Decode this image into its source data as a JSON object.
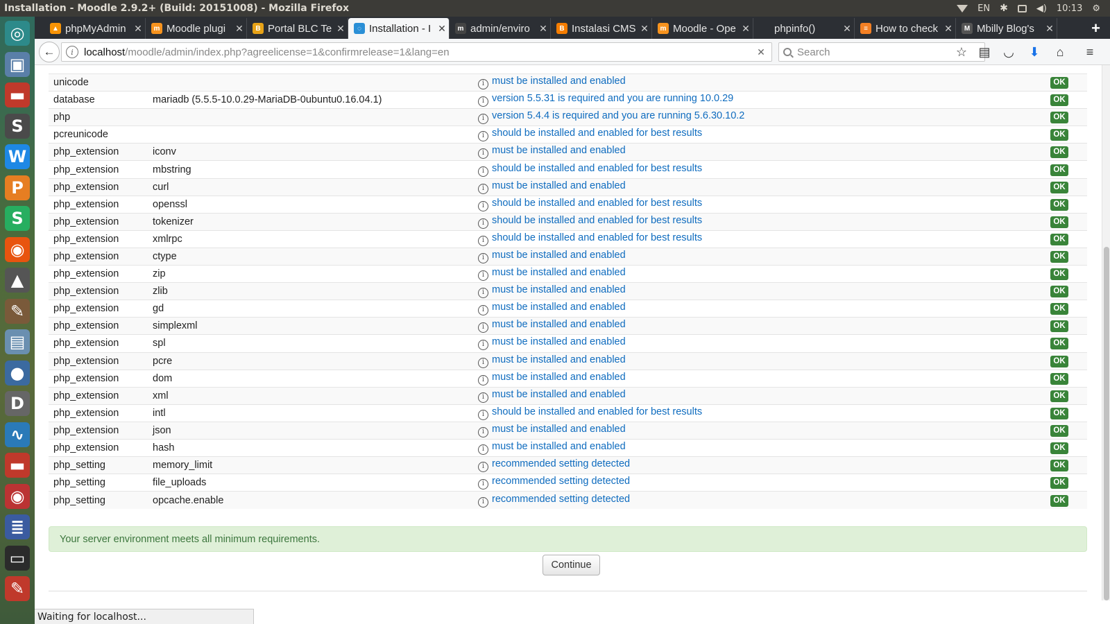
{
  "window": {
    "title": "Installation - Moodle 2.9.2+ (Build: 20151008) - Mozilla Firefox"
  },
  "system": {
    "language": "EN",
    "time": "10:13"
  },
  "tabs": [
    {
      "label": "phpMyAdmin",
      "favicon": "phpmyadmin-icon",
      "color": "#f89406",
      "glyph": "▲"
    },
    {
      "label": "Moodle plugi",
      "favicon": "moodle-icon",
      "color": "#f7931e",
      "glyph": "m"
    },
    {
      "label": "Portal BLC Te",
      "favicon": "blc-icon",
      "color": "#e8a317",
      "glyph": "B"
    },
    {
      "label": "Installation - I",
      "favicon": "loading-icon",
      "color": "#2a8fd6",
      "glyph": "◌",
      "active": true
    },
    {
      "label": "admin/enviro",
      "favicon": "moodle-icon",
      "color": "#444",
      "glyph": "m"
    },
    {
      "label": "Instalasi CMS",
      "favicon": "blogger-icon",
      "color": "#f57d00",
      "glyph": "B"
    },
    {
      "label": "Moodle - Ope",
      "favicon": "moodle-icon",
      "color": "#f7931e",
      "glyph": "m"
    },
    {
      "label": "phpinfo()",
      "favicon": "",
      "color": "transparent",
      "glyph": ""
    },
    {
      "label": "How to check",
      "favicon": "stackoverflow-icon",
      "color": "#f48024",
      "glyph": "≡"
    },
    {
      "label": "Mbilly Blog's",
      "favicon": "blog-icon",
      "color": "#555",
      "glyph": "M"
    }
  ],
  "nav": {
    "url_host": "localhost",
    "url_path": "/moodle/admin/index.php?agreelicense=1&confirmrelease=1&lang=en",
    "search_placeholder": "Search"
  },
  "environment": {
    "rows": [
      {
        "name": "unicode",
        "info": "",
        "report": "must be installed and enabled",
        "status": "OK"
      },
      {
        "name": "database",
        "info": "mariadb (5.5.5-10.0.29-MariaDB-0ubuntu0.16.04.1)",
        "report": "version 5.5.31 is required and you are running 10.0.29",
        "status": "OK"
      },
      {
        "name": "php",
        "info": "",
        "report": "version 5.4.4 is required and you are running 5.6.30.10.2",
        "status": "OK"
      },
      {
        "name": "pcreunicode",
        "info": "",
        "report": "should be installed and enabled for best results",
        "status": "OK"
      },
      {
        "name": "php_extension",
        "info": "iconv",
        "report": "must be installed and enabled",
        "status": "OK"
      },
      {
        "name": "php_extension",
        "info": "mbstring",
        "report": "should be installed and enabled for best results",
        "status": "OK"
      },
      {
        "name": "php_extension",
        "info": "curl",
        "report": "must be installed and enabled",
        "status": "OK"
      },
      {
        "name": "php_extension",
        "info": "openssl",
        "report": "should be installed and enabled for best results",
        "status": "OK"
      },
      {
        "name": "php_extension",
        "info": "tokenizer",
        "report": "should be installed and enabled for best results",
        "status": "OK"
      },
      {
        "name": "php_extension",
        "info": "xmlrpc",
        "report": "should be installed and enabled for best results",
        "status": "OK"
      },
      {
        "name": "php_extension",
        "info": "ctype",
        "report": "must be installed and enabled",
        "status": "OK"
      },
      {
        "name": "php_extension",
        "info": "zip",
        "report": "must be installed and enabled",
        "status": "OK"
      },
      {
        "name": "php_extension",
        "info": "zlib",
        "report": "must be installed and enabled",
        "status": "OK"
      },
      {
        "name": "php_extension",
        "info": "gd",
        "report": "must be installed and enabled",
        "status": "OK"
      },
      {
        "name": "php_extension",
        "info": "simplexml",
        "report": "must be installed and enabled",
        "status": "OK"
      },
      {
        "name": "php_extension",
        "info": "spl",
        "report": "must be installed and enabled",
        "status": "OK"
      },
      {
        "name": "php_extension",
        "info": "pcre",
        "report": "must be installed and enabled",
        "status": "OK"
      },
      {
        "name": "php_extension",
        "info": "dom",
        "report": "must be installed and enabled",
        "status": "OK"
      },
      {
        "name": "php_extension",
        "info": "xml",
        "report": "must be installed and enabled",
        "status": "OK"
      },
      {
        "name": "php_extension",
        "info": "intl",
        "report": "should be installed and enabled for best results",
        "status": "OK"
      },
      {
        "name": "php_extension",
        "info": "json",
        "report": "must be installed and enabled",
        "status": "OK"
      },
      {
        "name": "php_extension",
        "info": "hash",
        "report": "must be installed and enabled",
        "status": "OK"
      },
      {
        "name": "php_setting",
        "info": "memory_limit",
        "report": "recommended setting detected",
        "status": "OK"
      },
      {
        "name": "php_setting",
        "info": "file_uploads",
        "report": "recommended setting detected",
        "status": "OK"
      },
      {
        "name": "php_setting",
        "info": "opcache.enable",
        "report": "recommended setting detected",
        "status": "OK"
      }
    ],
    "summary": "Your server environment meets all minimum requirements.",
    "continue_label": "Continue"
  },
  "status_bar": {
    "text": "Waiting for localhost..."
  },
  "launcher_icons": [
    {
      "name": "dash-icon",
      "color": "#2d8a8a",
      "glyph": "◎"
    },
    {
      "name": "screenshot-icon",
      "color": "#5a7fa8",
      "glyph": "▣"
    },
    {
      "name": "files-icon",
      "color": "#c0392b",
      "glyph": "▬"
    },
    {
      "name": "sublime-icon",
      "color": "#4a4a4a",
      "glyph": "S"
    },
    {
      "name": "webstorm-icon",
      "color": "#1e88e5",
      "glyph": "W"
    },
    {
      "name": "phpstorm-icon",
      "color": "#e67e22",
      "glyph": "P"
    },
    {
      "name": "s-app-icon",
      "color": "#27ae60",
      "glyph": "S"
    },
    {
      "name": "firefox-icon",
      "color": "#e8540f",
      "glyph": "◉"
    },
    {
      "name": "upload-icon",
      "color": "#555",
      "glyph": "▲"
    },
    {
      "name": "inkscape-icon",
      "color": "#7a5a3a",
      "glyph": "✎"
    },
    {
      "name": "archive-icon",
      "color": "#6a8fb0",
      "glyph": "▤"
    },
    {
      "name": "maps-icon",
      "color": "#3b6aa0",
      "glyph": "●"
    },
    {
      "name": "d-app-icon",
      "color": "#666",
      "glyph": "D"
    },
    {
      "name": "monitor-icon",
      "color": "#2a7ab8",
      "glyph": "∿"
    },
    {
      "name": "screen-recorder-icon",
      "color": "#c0392b",
      "glyph": "▬"
    },
    {
      "name": "document-viewer-icon",
      "color": "#b33",
      "glyph": "◉"
    },
    {
      "name": "text-editor-icon",
      "color": "#3a5ba0",
      "glyph": "≣"
    },
    {
      "name": "terminal-icon",
      "color": "#2b2b2b",
      "glyph": "▭"
    },
    {
      "name": "draw-icon",
      "color": "#c0392b",
      "glyph": "✎"
    }
  ]
}
